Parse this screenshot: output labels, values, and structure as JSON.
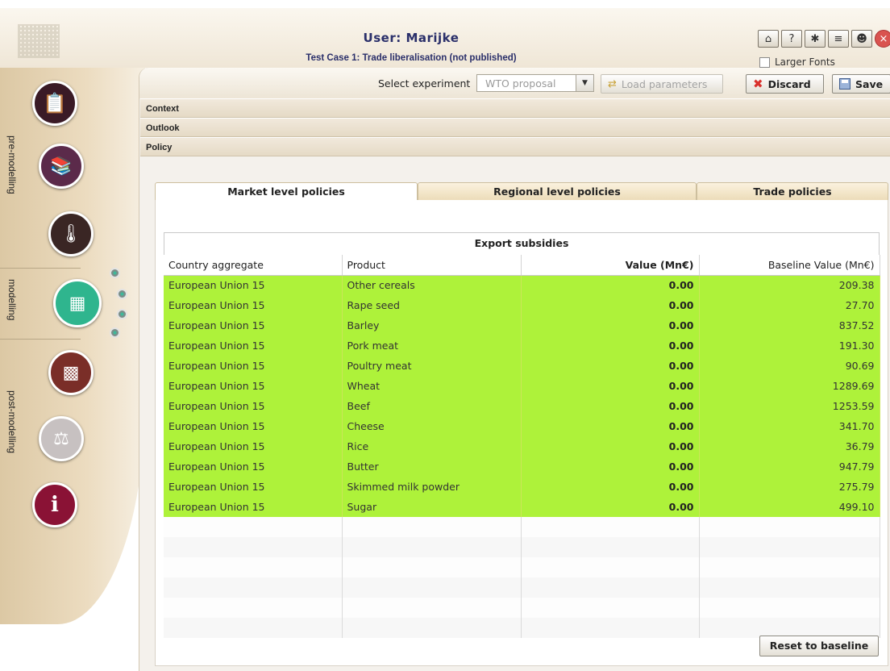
{
  "header": {
    "user_title": "User: Marijke",
    "case_title": "Test Case 1: Trade liberalisation (not published)",
    "larger_fonts_label": "Larger Fonts",
    "icons": [
      "home-icon",
      "help-icon",
      "bug-icon",
      "bookmark-icon",
      "users-icon",
      "close-icon"
    ]
  },
  "sidebar": {
    "sections": [
      "pre-modelling",
      "modelling",
      "post-modelling"
    ],
    "steps": [
      {
        "icon": "clipboard-icon",
        "color": "#3a1a26"
      },
      {
        "icon": "books-icon",
        "color": "#5b2a4a"
      },
      {
        "icon": "thermometer-icon",
        "color": "#3a2624"
      },
      {
        "icon": "calculator-icon",
        "color": "#2fb58e"
      },
      {
        "icon": "chart-grid-icon",
        "color": "#7a2e28"
      },
      {
        "icon": "scales-icon",
        "color": "#c7c1c1"
      },
      {
        "icon": "info-icon",
        "color": "#8a1235"
      }
    ]
  },
  "toolbar": {
    "select_label": "Select experiment",
    "select_value": "WTO proposal",
    "load_label": "Load parameters",
    "discard_label": "Discard",
    "save_label": "Save"
  },
  "accordion": [
    "Context",
    "Outlook",
    "Policy"
  ],
  "tabs": [
    "Market level policies",
    "Regional level policies",
    "Trade policies"
  ],
  "table": {
    "title": "Export subsidies",
    "columns": [
      "Country aggregate",
      "Product",
      "Value (Mn€)",
      "Baseline Value (Mn€)"
    ],
    "rows": [
      [
        "European Union 15",
        "Other cereals",
        "0.00",
        "209.38"
      ],
      [
        "European Union 15",
        "Rape seed",
        "0.00",
        "27.70"
      ],
      [
        "European Union 15",
        "Barley",
        "0.00",
        "837.52"
      ],
      [
        "European Union 15",
        "Pork meat",
        "0.00",
        "191.30"
      ],
      [
        "European Union 15",
        "Poultry meat",
        "0.00",
        "90.69"
      ],
      [
        "European Union 15",
        "Wheat",
        "0.00",
        "1289.69"
      ],
      [
        "European Union 15",
        "Beef",
        "0.00",
        "1253.59"
      ],
      [
        "European Union 15",
        "Cheese",
        "0.00",
        "341.70"
      ],
      [
        "European Union 15",
        "Rice",
        "0.00",
        "36.79"
      ],
      [
        "European Union 15",
        "Butter",
        "0.00",
        "947.79"
      ],
      [
        "European Union 15",
        "Skimmed milk powder",
        "0.00",
        "275.79"
      ],
      [
        "European Union 15",
        "Sugar",
        "0.00",
        "499.10"
      ]
    ],
    "highlight_color": "#aef23a"
  },
  "reset_label": "Reset to baseline"
}
